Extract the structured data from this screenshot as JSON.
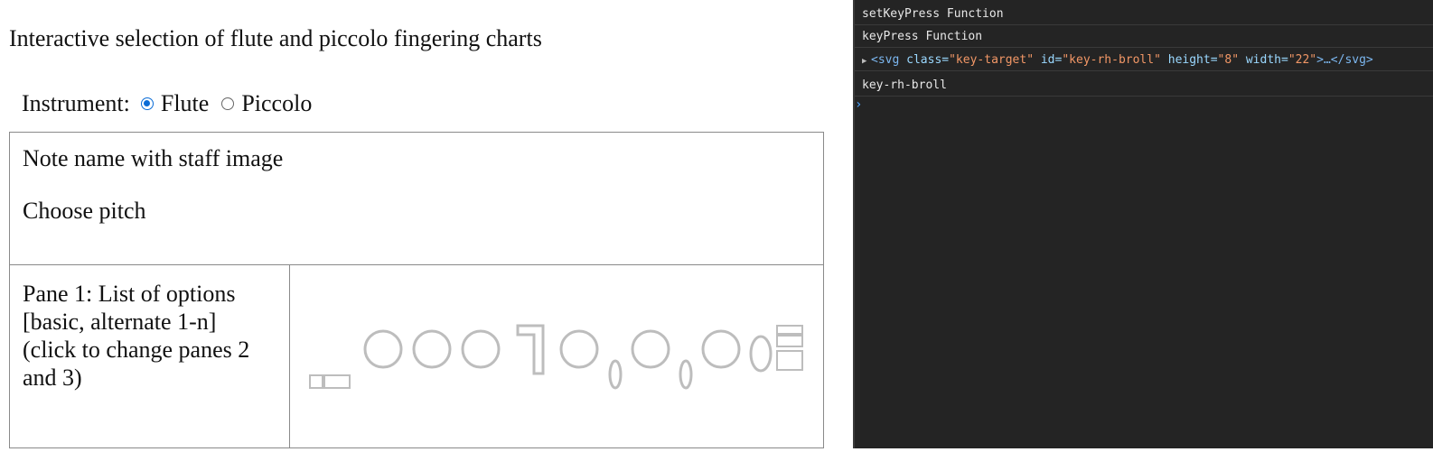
{
  "page": {
    "title": "Interactive selection of flute and piccolo fingering charts",
    "instrument": {
      "label": "Instrument:",
      "options": [
        "Flute",
        "Piccolo"
      ],
      "selected": "Flute"
    },
    "note_box": {
      "line1": "Note name with staff image",
      "line2": "Choose pitch"
    },
    "pane1": {
      "lines": [
        "Pane 1: List of options",
        "[basic, alternate 1-n]",
        "(click to change panes 2",
        "and 3)"
      ]
    },
    "diagram": {
      "key_color": "#bdbdbd"
    }
  },
  "devtools": {
    "rows": [
      {
        "text": "setKeyPress Function"
      },
      {
        "text": "keyPress Function"
      },
      {
        "tag_open": "<svg",
        "attr1": "class=",
        "val1": "\"key-target\"",
        "attr2": "id=",
        "val2": "\"key-rh-broll\"",
        "attr3": "height=",
        "val3": "\"8\"",
        "attr4": "width=",
        "val4": "\"22\"",
        "tag_close": ">…</svg>"
      },
      {
        "text": "key-rh-broll"
      }
    ],
    "prompt": "›"
  }
}
